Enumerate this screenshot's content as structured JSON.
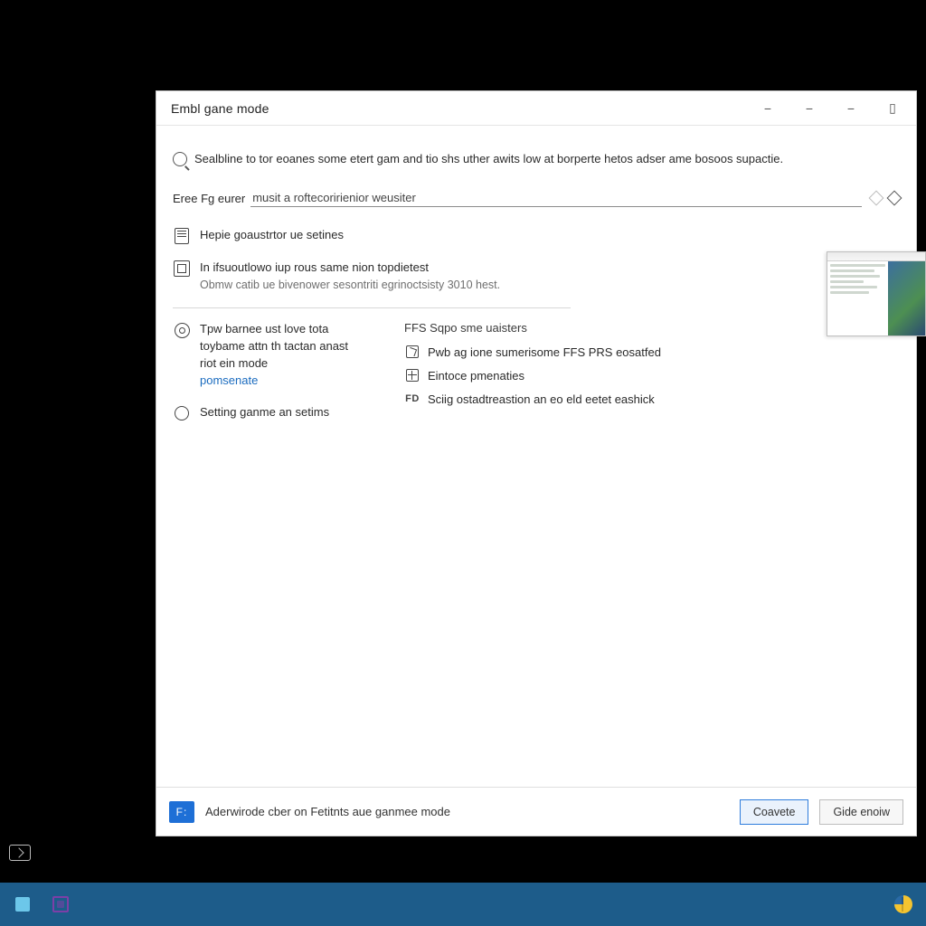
{
  "window": {
    "title": "Embl gane mode",
    "intro": "Sealbline to tor eoanes some etert gam and tio shs uther awits low at borperte hetos adser ame bosoos supactie.",
    "form_label": "Eree Fg eurer",
    "input_value": "musit a roftecoririenior weusiter",
    "list": {
      "help": "Hepie goaustrtor ue setines",
      "info_title": "In ifsuoutlowo iup rous same nion topdietest",
      "info_sub": "Obmw catib ue bivenower sesontriti egrinoctsisty 3010 hest.",
      "tow_title": "Tpw barnee ust love tota toybame attn th tactan anast riot ein mode",
      "tow_link": "pomsenate",
      "setting": "Setting ganme an setims"
    },
    "right_col": {
      "header": "FFS Sqpo sme uaisters",
      "r1": "Pwb ag ione sumerisome FFS PRS eosatfed",
      "r2": "Eintoce pmenaties",
      "r3": "Sciig ostadtreastion an eo eld eetet eashick"
    },
    "footer": {
      "text": "Aderwirode cber on Fetitnts aue ganmee mode",
      "ok": "Coavete",
      "cancel": "Gide enoiw"
    }
  }
}
